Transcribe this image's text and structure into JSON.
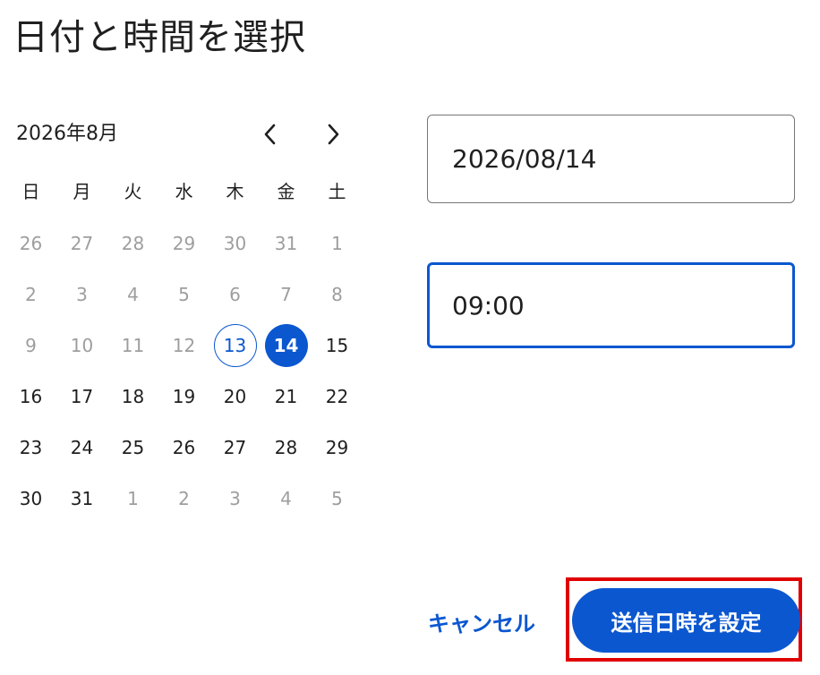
{
  "dialog": {
    "title": "日付と時間を選択"
  },
  "calendar": {
    "month_label": "2026年8月",
    "prev_icon": "chevron-left-icon",
    "next_icon": "chevron-right-icon",
    "weekdays": [
      "日",
      "月",
      "火",
      "水",
      "木",
      "金",
      "土"
    ],
    "weeks": [
      [
        {
          "d": "26",
          "muted": true
        },
        {
          "d": "27",
          "muted": true
        },
        {
          "d": "28",
          "muted": true
        },
        {
          "d": "29",
          "muted": true
        },
        {
          "d": "30",
          "muted": true
        },
        {
          "d": "31",
          "muted": true
        },
        {
          "d": "1",
          "muted": true
        }
      ],
      [
        {
          "d": "2",
          "muted": true
        },
        {
          "d": "3",
          "muted": true
        },
        {
          "d": "4",
          "muted": true
        },
        {
          "d": "5",
          "muted": true
        },
        {
          "d": "6",
          "muted": true
        },
        {
          "d": "7",
          "muted": true
        },
        {
          "d": "8",
          "muted": true
        }
      ],
      [
        {
          "d": "9",
          "muted": true
        },
        {
          "d": "10",
          "muted": true
        },
        {
          "d": "11",
          "muted": true
        },
        {
          "d": "12",
          "muted": true
        },
        {
          "d": "13",
          "today": true
        },
        {
          "d": "14",
          "selected": true
        },
        {
          "d": "15"
        }
      ],
      [
        {
          "d": "16"
        },
        {
          "d": "17"
        },
        {
          "d": "18"
        },
        {
          "d": "19"
        },
        {
          "d": "20"
        },
        {
          "d": "21"
        },
        {
          "d": "22"
        }
      ],
      [
        {
          "d": "23"
        },
        {
          "d": "24"
        },
        {
          "d": "25"
        },
        {
          "d": "26"
        },
        {
          "d": "27"
        },
        {
          "d": "28"
        },
        {
          "d": "29"
        }
      ],
      [
        {
          "d": "30"
        },
        {
          "d": "31"
        },
        {
          "d": "1",
          "muted": true
        },
        {
          "d": "2",
          "muted": true
        },
        {
          "d": "3",
          "muted": true
        },
        {
          "d": "4",
          "muted": true
        },
        {
          "d": "5",
          "muted": true
        }
      ]
    ]
  },
  "date_field": {
    "value": "2026/08/14"
  },
  "time_field": {
    "value": "09:00"
  },
  "actions": {
    "cancel_label": "キャンセル",
    "submit_label": "送信日時を設定"
  },
  "colors": {
    "accent": "#0b57d0",
    "highlight": "#e00000",
    "muted_text": "#9e9e9e"
  }
}
